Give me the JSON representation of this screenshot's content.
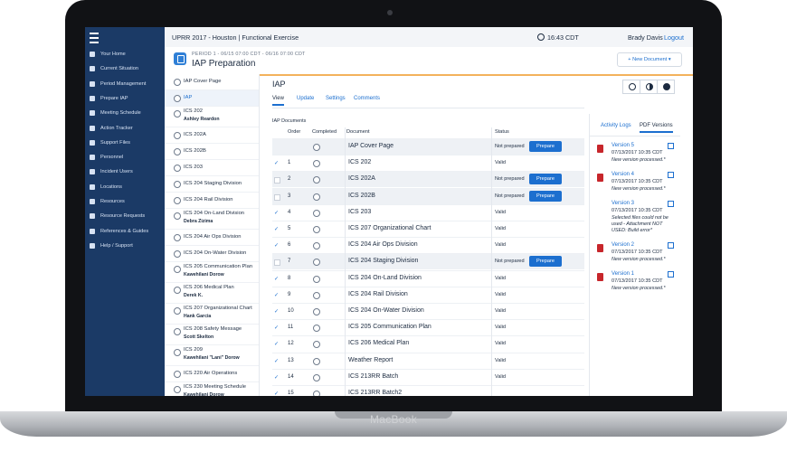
{
  "device": {
    "brand": "MacBook"
  },
  "topbar": {
    "title": "UPRR 2017 - Houston | Functional Exercise",
    "time": "16:43 CDT",
    "user": "Brady Davis",
    "logout": "Logout"
  },
  "sidebar": {
    "items": [
      {
        "label": "Your Home",
        "icon": "home-icon"
      },
      {
        "label": "Current Situation",
        "icon": "pulse-icon"
      },
      {
        "label": "Period Management",
        "icon": "clock-icon"
      },
      {
        "label": "Prepare IAP",
        "icon": "document-icon"
      },
      {
        "label": "Meeting Schedule",
        "icon": "people-icon"
      },
      {
        "label": "Action Tracker",
        "icon": "checklist-icon"
      },
      {
        "label": "Support Files",
        "icon": "folder-icon"
      },
      {
        "label": "Personnel",
        "icon": "person-icon"
      },
      {
        "label": "Incident Users",
        "icon": "users-icon"
      },
      {
        "label": "Locations",
        "icon": "pin-icon"
      },
      {
        "label": "Resources",
        "icon": "truck-icon"
      },
      {
        "label": "Resource Requests",
        "icon": "request-icon"
      },
      {
        "label": "References & Guides",
        "icon": "list-icon"
      },
      {
        "label": "Help / Support",
        "icon": "help-icon"
      }
    ]
  },
  "header": {
    "period": "PERIOD 1 - 06/15 07:00 CDT - 06/16 07:00 CDT",
    "title": "IAP Preparation",
    "new_document": "+ New Document ▾"
  },
  "doclist": [
    {
      "name": "IAP Cover Page",
      "sub": ""
    },
    {
      "name": "IAP",
      "sub": "",
      "selected": true
    },
    {
      "name": "ICS 202",
      "sub": "Ashley Reardon"
    },
    {
      "name": "ICS 202A",
      "sub": ""
    },
    {
      "name": "ICS 202B",
      "sub": ""
    },
    {
      "name": "ICS 203",
      "sub": ""
    },
    {
      "name": "ICS 204 Staging Division",
      "sub": ""
    },
    {
      "name": "ICS 204 Rail Division",
      "sub": ""
    },
    {
      "name": "ICS 204 On-Land Division",
      "sub": "Debra Zizima"
    },
    {
      "name": "ICS 204 Air Ops Division",
      "sub": ""
    },
    {
      "name": "ICS 204 On-Water Division",
      "sub": ""
    },
    {
      "name": "ICS 205 Communication Plan",
      "sub": "Kawehilani Dorow"
    },
    {
      "name": "ICS 206 Medical Plan",
      "sub": "Derek K."
    },
    {
      "name": "ICS 207 Organizational Chart",
      "sub": "Hank Garcia"
    },
    {
      "name": "ICS 208 Safety Message",
      "sub": "Scott Skelton"
    },
    {
      "name": "ICS 209",
      "sub": "Kawehilani \"Lani\" Dorow"
    },
    {
      "name": "ICS 220 Air Operations",
      "sub": ""
    },
    {
      "name": "ICS 230 Meeting Schedule",
      "sub": "Kawehilani Dorow"
    },
    {
      "name": "ICS 231",
      "sub": ""
    }
  ],
  "main": {
    "title": "IAP",
    "tabs": [
      "View",
      "Update",
      "Settings",
      "Comments"
    ],
    "table_caption": "IAP Documents",
    "columns": [
      "Order",
      "Completed",
      "Document",
      "Status"
    ],
    "prepare_label": "Prepare",
    "rows": [
      {
        "check": "",
        "order": "",
        "doc": "IAP Cover Page",
        "status": "Not prepared",
        "prepare": true
      },
      {
        "check": "✓",
        "order": "1",
        "doc": "ICS 202",
        "status": "Valid",
        "prepare": false
      },
      {
        "check": "box",
        "order": "2",
        "doc": "ICS 202A",
        "status": "Not prepared",
        "prepare": true
      },
      {
        "check": "box",
        "order": "3",
        "doc": "ICS 202B",
        "status": "Not prepared",
        "prepare": true
      },
      {
        "check": "✓",
        "order": "4",
        "doc": "ICS 203",
        "status": "Valid",
        "prepare": false
      },
      {
        "check": "✓",
        "order": "5",
        "doc": "ICS 207 Organizational Chart",
        "status": "Valid",
        "prepare": false
      },
      {
        "check": "✓",
        "order": "6",
        "doc": "ICS 204 Air Ops Division",
        "status": "Valid",
        "prepare": false
      },
      {
        "check": "box",
        "order": "7",
        "doc": "ICS 204 Staging Division",
        "status": "Not prepared",
        "prepare": true
      },
      {
        "check": "✓",
        "order": "8",
        "doc": "ICS 204 On-Land Division",
        "status": "Valid",
        "prepare": false
      },
      {
        "check": "✓",
        "order": "9",
        "doc": "ICS 204 Rail Division",
        "status": "Valid",
        "prepare": false
      },
      {
        "check": "✓",
        "order": "10",
        "doc": "ICS 204 On-Water Division",
        "status": "Valid",
        "prepare": false
      },
      {
        "check": "✓",
        "order": "11",
        "doc": "ICS 205 Communication Plan",
        "status": "Valid",
        "prepare": false
      },
      {
        "check": "✓",
        "order": "12",
        "doc": "ICS 206 Medical Plan",
        "status": "Valid",
        "prepare": false
      },
      {
        "check": "✓",
        "order": "13",
        "doc": "Weather Report",
        "status": "Valid",
        "prepare": false
      },
      {
        "check": "✓",
        "order": "14",
        "doc": "ICS 213RR Batch",
        "status": "Valid",
        "prepare": false
      },
      {
        "check": "✓",
        "order": "15",
        "doc": "ICS 213RR Batch2",
        "status": "",
        "prepare": false
      }
    ]
  },
  "panel": {
    "tabs": [
      "Activity Logs",
      "PDF Versions"
    ],
    "versions": [
      {
        "name": "Version 5",
        "date": "07/13/2017 10:35 CDT",
        "note": "New version processed.*",
        "pdf": true
      },
      {
        "name": "Version 4",
        "date": "07/13/2017 10:35 CDT",
        "note": "New version processed.*",
        "pdf": true
      },
      {
        "name": "Version 3",
        "date": "07/13/2017 10:35 CDT",
        "note": "Selected files could not be used - Attachment NOT USED: Build error*",
        "pdf": false
      },
      {
        "name": "Version 2",
        "date": "07/13/2017 10:35 CDT",
        "note": "New version processed.*",
        "pdf": true
      },
      {
        "name": "Version 1",
        "date": "07/13/2017 10:35 CDT",
        "note": "New version processed.*",
        "pdf": true
      }
    ]
  },
  "colors": {
    "sidebar": "#1b3a66",
    "accent": "#1c6fcf",
    "header_rule": "#f3b25c",
    "pdf": "#c7262b"
  }
}
